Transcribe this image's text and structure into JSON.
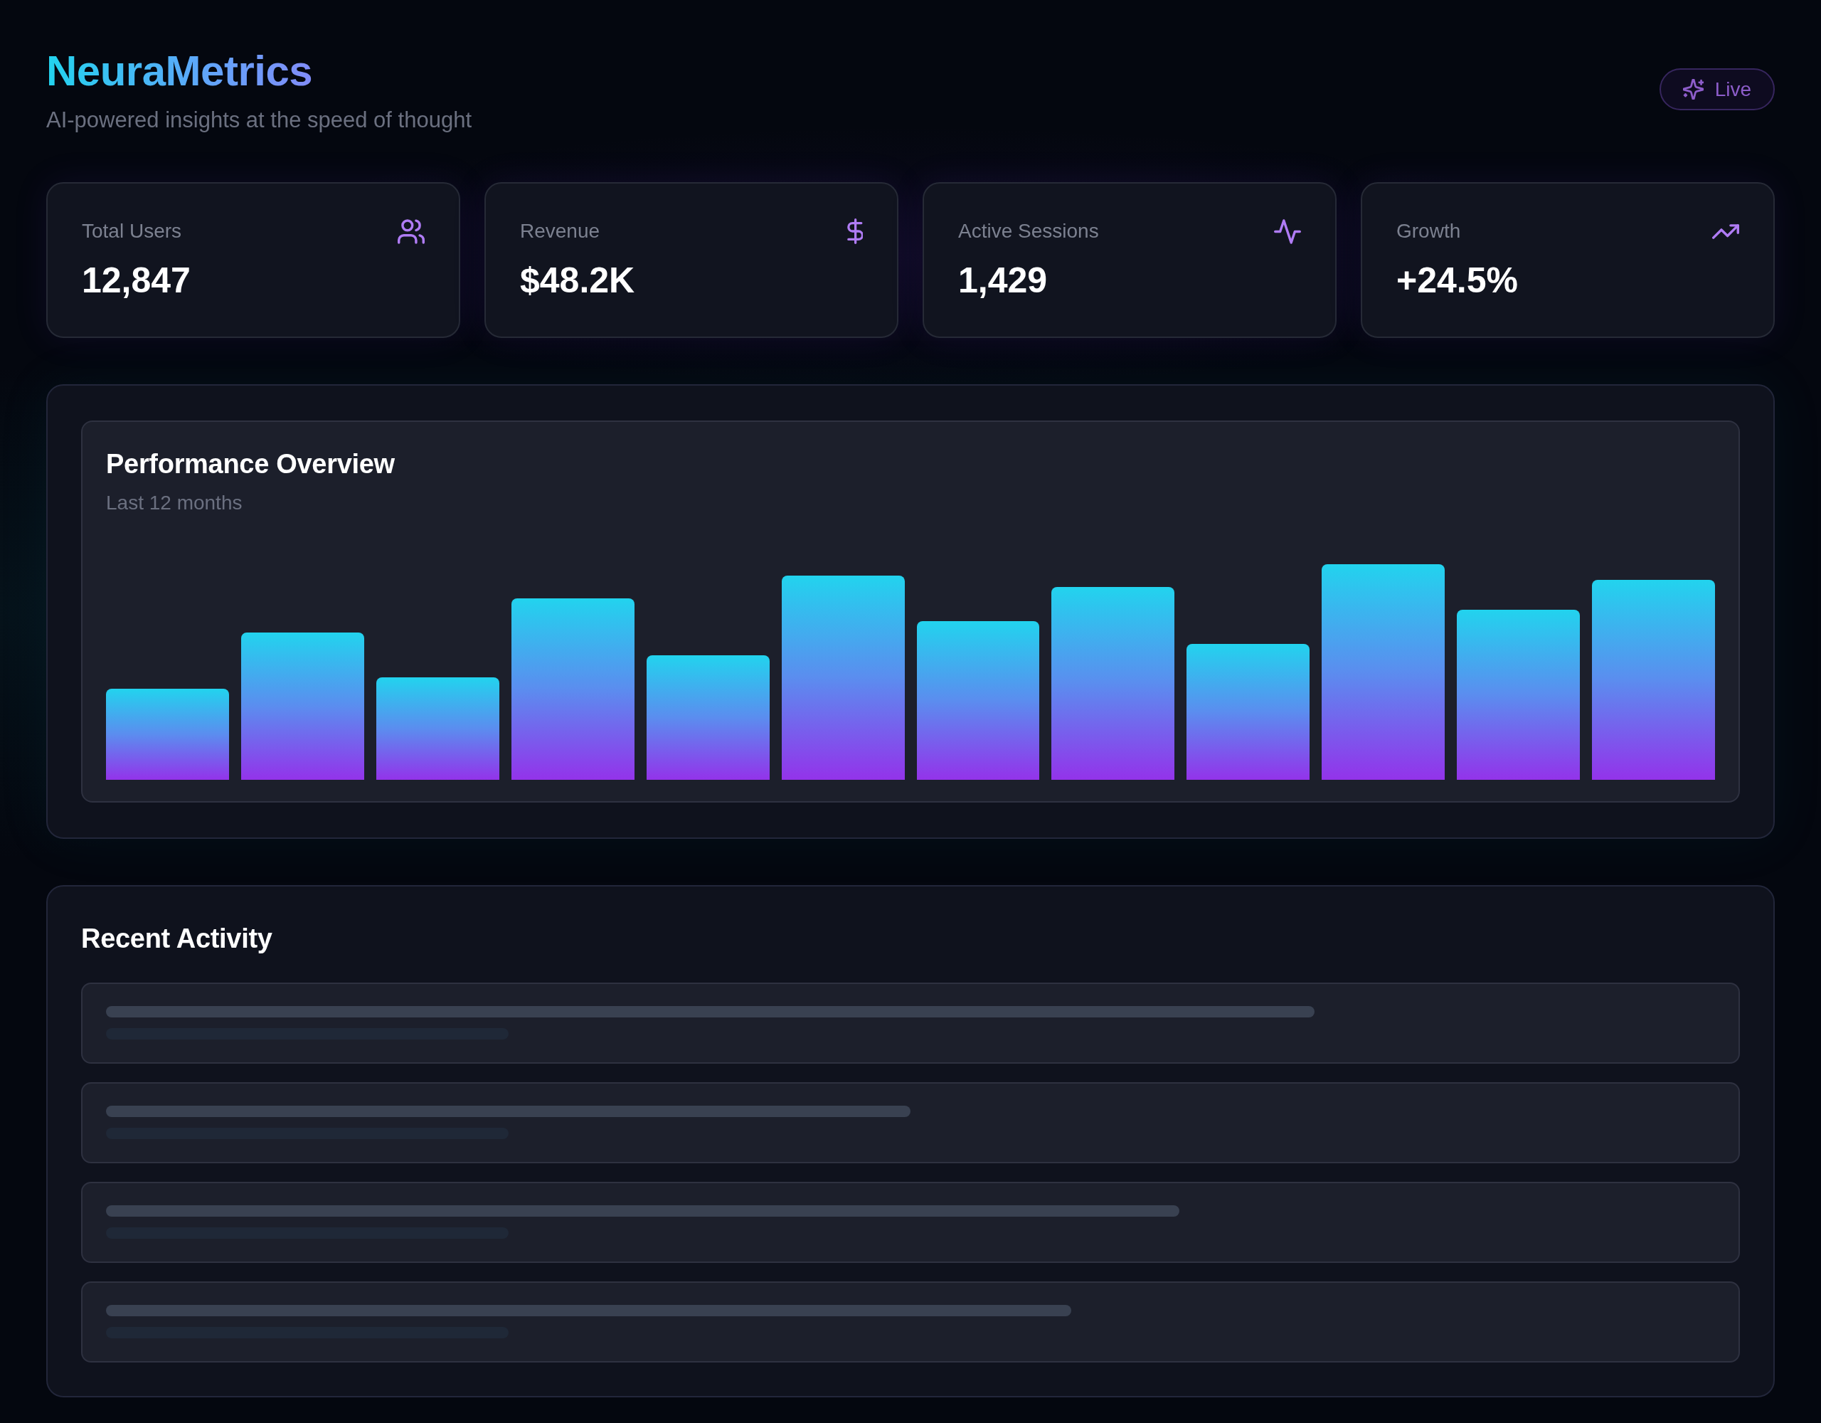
{
  "header": {
    "title": "NeuraMetrics",
    "subtitle": "AI-powered insights at the speed of thought",
    "status_badge": {
      "label": "Live"
    }
  },
  "stats": [
    {
      "label": "Total Users",
      "value": "12,847"
    },
    {
      "label": "Revenue",
      "value": "$48.2K"
    },
    {
      "label": "Active Sessions",
      "value": "1,429"
    },
    {
      "label": "Growth",
      "value": "+24.5%"
    }
  ],
  "performance": {
    "title": "Performance Overview",
    "subtitle": "Last 12 months"
  },
  "activity": {
    "title": "Recent Activity",
    "loading": true
  }
}
